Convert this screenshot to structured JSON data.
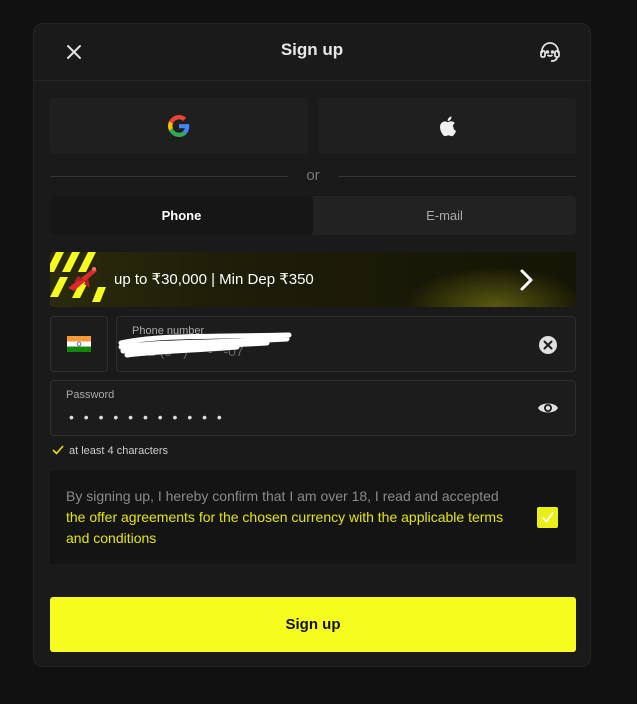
{
  "modal": {
    "title": "Sign up",
    "close_icon": "close-icon",
    "support_icon": "headset-icon"
  },
  "social": {
    "google_icon": "google-icon",
    "apple_icon": "apple-icon",
    "or_text": "or"
  },
  "tabs": {
    "phone_label": "Phone",
    "email_label": "E-mail",
    "selected": "Phone"
  },
  "promo": {
    "text": "up to ₹30,000 | Min Dep ₹350",
    "icon": "airplane-icon",
    "arrow_icon": "chevron-right-icon"
  },
  "phone_field": {
    "country_flag": "india-flag-icon",
    "label": "Phone number",
    "value": "+91 (9**) ***-**-07",
    "clear_icon": "clear-circle-icon"
  },
  "password_field": {
    "label": "Password",
    "value_masked": "• • • • • • • • • • •",
    "toggle_icon": "eye-icon"
  },
  "password_hint": {
    "text": "at least 4 characters"
  },
  "terms": {
    "text": "By signing up, I hereby confirm that I am over 18, I read and accepted ",
    "link_text": "the offer agreements for the chosen currency with the applicable terms and conditions",
    "checked": true
  },
  "submit": {
    "label": "Sign up"
  },
  "colors": {
    "accent": "#f5fc1e",
    "link": "#e5e600",
    "background": "#111111",
    "panel": "#1a1a1a"
  }
}
